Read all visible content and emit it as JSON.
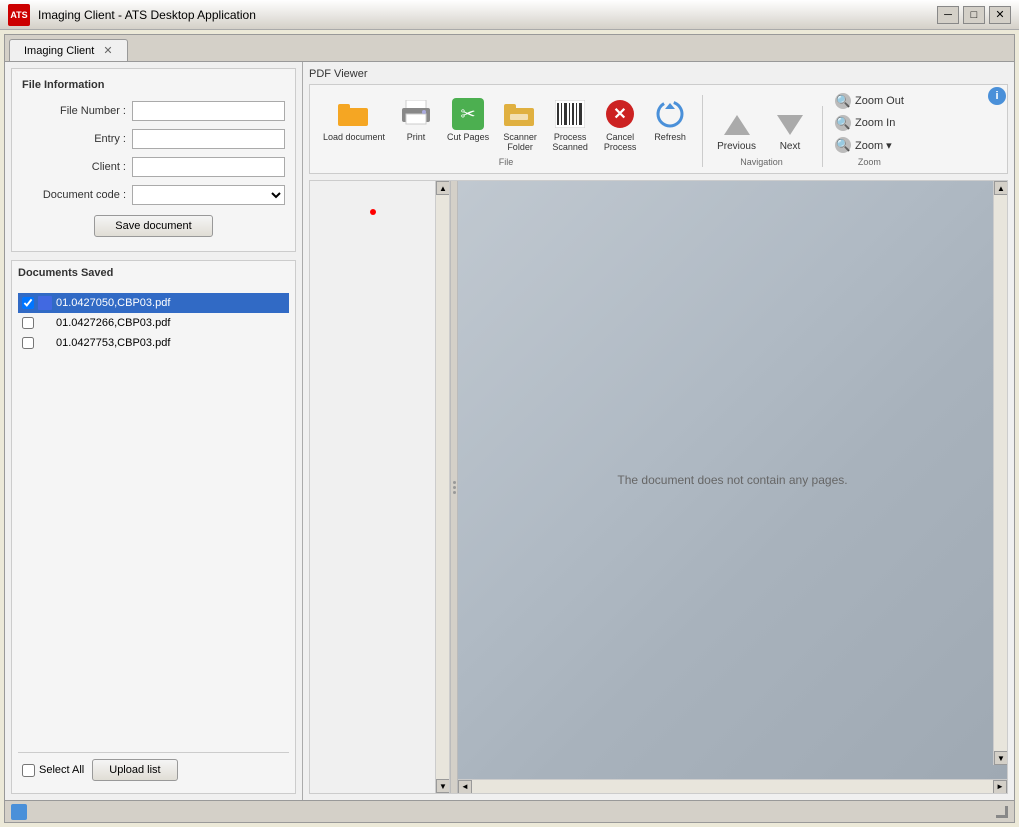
{
  "window": {
    "title": "Imaging Client - ATS Desktop Application",
    "logo": "ATS",
    "controls": {
      "minimize": "─",
      "maximize": "□",
      "close": "✕"
    }
  },
  "tabs": [
    {
      "label": "Imaging Client",
      "active": true,
      "closable": true
    }
  ],
  "left_panel": {
    "file_info_title": "File Information",
    "fields": [
      {
        "label": "File Number :",
        "value": "",
        "placeholder": ""
      },
      {
        "label": "Entry :",
        "value": "",
        "placeholder": ""
      },
      {
        "label": "Client :",
        "value": "",
        "placeholder": ""
      },
      {
        "label": "Document code :",
        "value": "",
        "type": "select"
      }
    ],
    "save_button": "Save document",
    "documents_saved_title": "Documents Saved",
    "documents": [
      {
        "name": "01.0427050,CBP03.pdf",
        "selected": true
      },
      {
        "name": "01.0427266,CBP03.pdf",
        "selected": false
      },
      {
        "name": "01.0427753,CBP03.pdf",
        "selected": false
      }
    ],
    "select_all_label": "Select All",
    "upload_button": "Upload list"
  },
  "right_panel": {
    "title": "PDF Viewer",
    "toolbar": {
      "groups": [
        {
          "name": "File",
          "buttons": [
            {
              "label": "Load document",
              "icon": "folder"
            },
            {
              "label": "Print",
              "icon": "printer"
            },
            {
              "label": "Cut Pages",
              "icon": "scissors"
            },
            {
              "label": "Scanner\nFolder",
              "icon": "scanner-folder"
            },
            {
              "label": "Process\nScanned",
              "icon": "barcode"
            },
            {
              "label": "Cancel\nProcess",
              "icon": "cancel"
            },
            {
              "label": "Refresh",
              "icon": "refresh"
            }
          ]
        },
        {
          "name": "Navigation",
          "buttons": [
            {
              "label": "Previous",
              "icon": "arrow-up"
            },
            {
              "label": "Next",
              "icon": "arrow-down"
            }
          ]
        },
        {
          "name": "Zoom",
          "buttons": [
            {
              "label": "Zoom Out",
              "icon": "zoom-out"
            },
            {
              "label": "Zoom In",
              "icon": "zoom-in"
            },
            {
              "label": "Zoom",
              "icon": "zoom"
            }
          ]
        }
      ]
    },
    "empty_message": "The document does not contain any pages."
  },
  "info_button": "i",
  "status_bar": {
    "text": ""
  }
}
